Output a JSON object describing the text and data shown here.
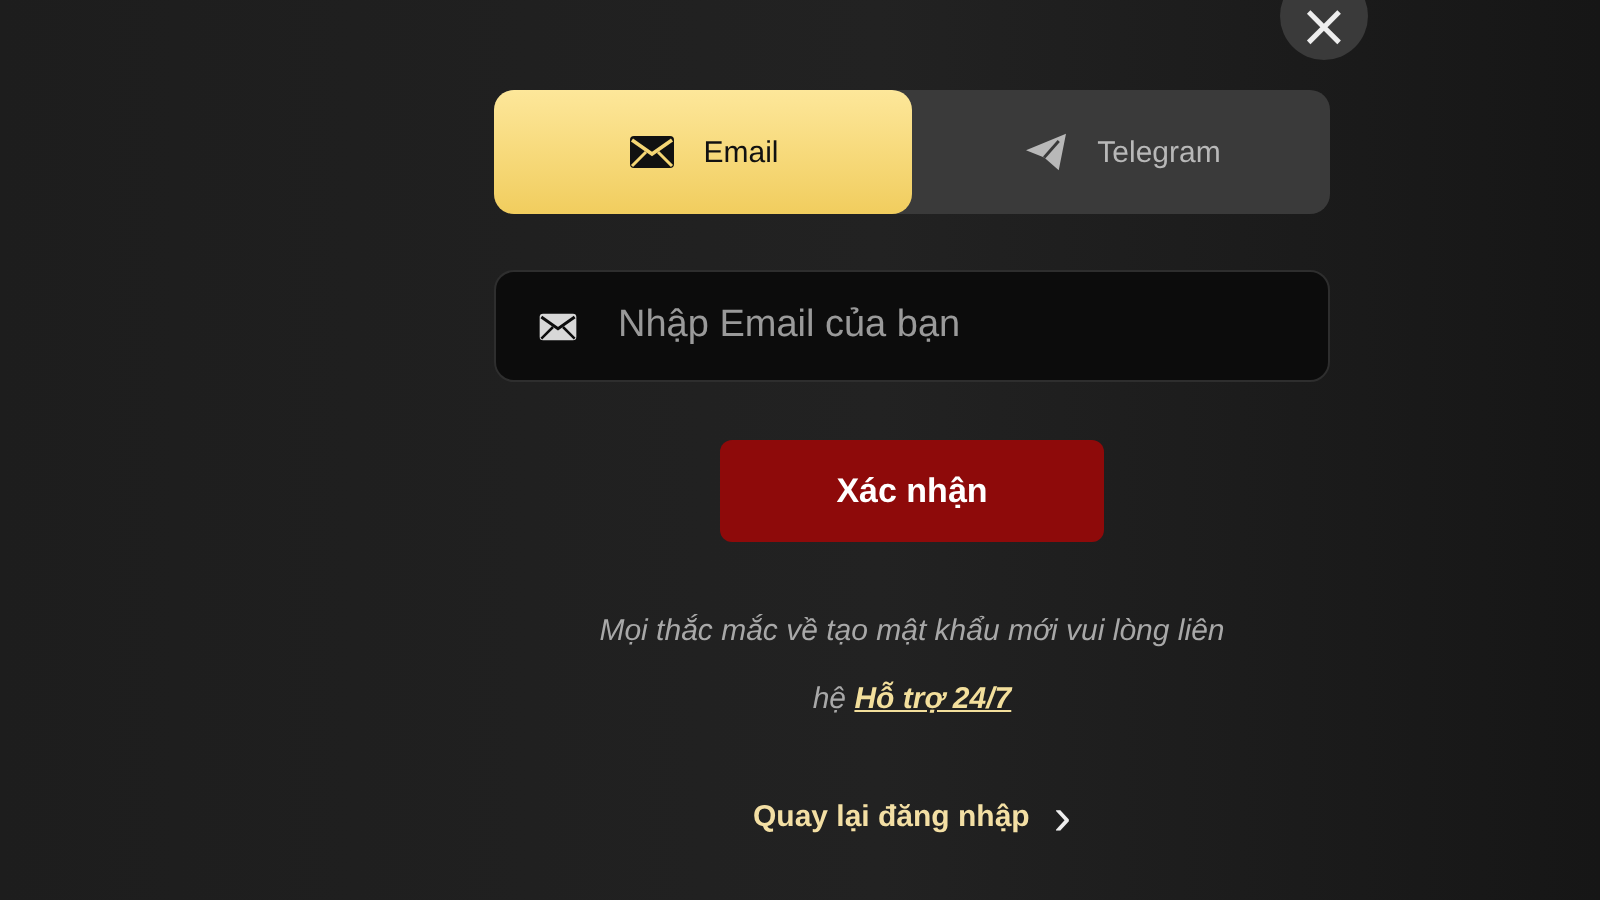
{
  "close_button": {
    "label": "×"
  },
  "tabs": [
    {
      "label": "Email",
      "kind": "email",
      "selected": true
    },
    {
      "label": "Telegram",
      "kind": "telegram",
      "selected": false
    }
  ],
  "email_field": {
    "placeholder": "Nhập Email của bạn"
  },
  "submit_button": {
    "label": "Xác nhận"
  },
  "help": {
    "text": "Mọi thắc mắc về tạo mật khẩu mới vui lòng liên hệ",
    "link": "Hỗ trợ 24/7"
  },
  "back_link": {
    "label": "Quay lại đăng nhập",
    "icon": "›"
  }
}
